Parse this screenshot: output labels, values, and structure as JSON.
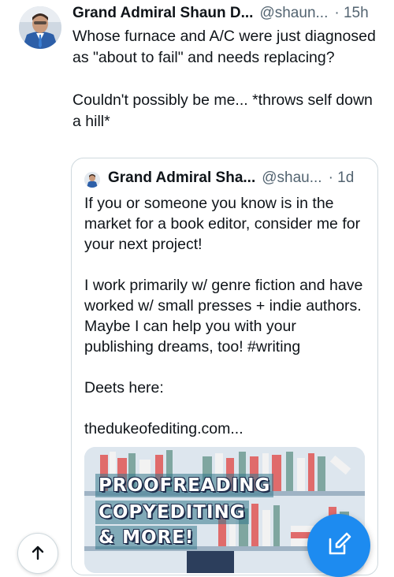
{
  "post": {
    "author_name": "Grand Admiral Shaun D...",
    "handle": "@shaun...",
    "timestamp": "· 15h",
    "text": "Whose furnace and A/C were just diagnosed as \"about to fail\" and needs replacing?\n\nCouldn't possibly be me... *throws self down a hill*"
  },
  "quoted_post": {
    "author_name": "Grand Admiral Sha...",
    "handle": "@shau...",
    "timestamp": "· 1d",
    "text": "If you or someone you know is in the market for a book editor, consider me for your next project!\n\nI work primarily w/ genre fiction and have worked w/ small presses + indie authors. Maybe I can help you with your publishing dreams, too! #writing\n\nDeets here:\n\nthedukeofediting.com...",
    "image": {
      "lines": [
        "PROOFREADING",
        "COPYEDITING",
        "& MORE!"
      ]
    }
  },
  "icons": {
    "scroll_up": "arrow-up-icon",
    "compose": "compose-icon"
  },
  "colors": {
    "accent": "#1d8bf0",
    "secondary_text": "#536471",
    "border": "#cfd9de"
  }
}
